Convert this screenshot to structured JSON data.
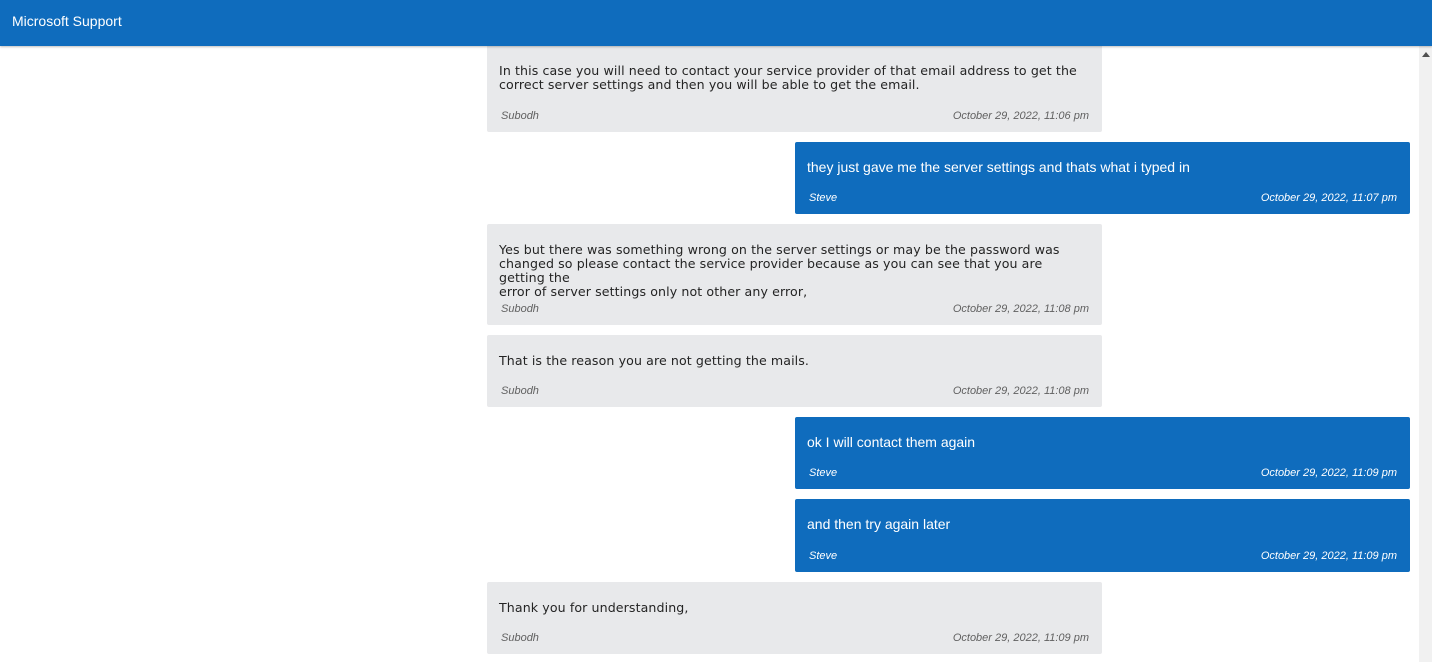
{
  "header": {
    "title": "Microsoft Support"
  },
  "messages": [
    {
      "role": "agent",
      "lines": [
        "In this case you will need to contact your service provider of that email address to get the",
        "correct server settings and then you will be able to get the email."
      ],
      "author": "Subodh",
      "time": "October 29, 2022, 11:06 pm"
    },
    {
      "role": "user",
      "lines": [
        "they just gave me the server settings and thats what i typed in"
      ],
      "author": "Steve",
      "time": "October 29, 2022, 11:07 pm"
    },
    {
      "role": "agent",
      "lines": [
        "Yes but there was something wrong on the server settings or may be the password was",
        "changed so please contact the service provider because as you can see that you are getting the",
        "error of server settings only not other any error,"
      ],
      "author": "Subodh",
      "time": "October 29, 2022, 11:08 pm"
    },
    {
      "role": "agent",
      "lines": [
        "That is the reason you are not getting the mails."
      ],
      "author": "Subodh",
      "time": "October 29, 2022, 11:08 pm"
    },
    {
      "role": "user",
      "lines": [
        "ok I will contact them again"
      ],
      "author": "Steve",
      "time": "October 29, 2022, 11:09 pm"
    },
    {
      "role": "user",
      "lines": [
        "and then try again later"
      ],
      "author": "Steve",
      "time": "October 29, 2022, 11:09 pm"
    },
    {
      "role": "agent",
      "lines": [
        "Thank you for understanding,"
      ],
      "author": "Subodh",
      "time": "October 29, 2022, 11:09 pm"
    }
  ]
}
